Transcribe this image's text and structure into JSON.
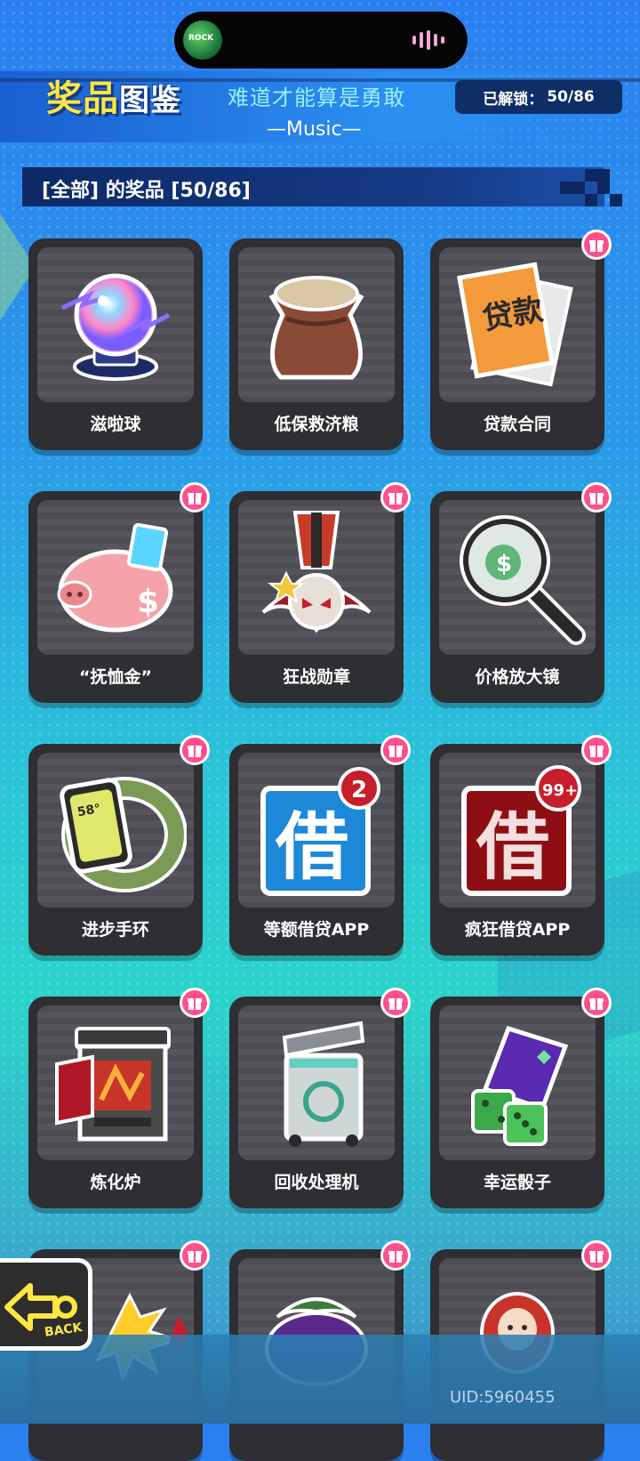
{
  "status": {
    "music_art_text": "ROCK"
  },
  "header": {
    "title_part1": "奖品",
    "title_part2": "图鉴",
    "song_title": "难道才能算是勇敢",
    "genre": "—Music—",
    "unlocked_label": "已解锁：",
    "unlocked_count": "50/86"
  },
  "section": {
    "title": "[全部] 的奖品 [50/86]"
  },
  "items": [
    {
      "name": "滋啦球",
      "gift": false
    },
    {
      "name": "低保救济粮",
      "gift": false
    },
    {
      "name": "贷款合同",
      "gift": true
    },
    {
      "name": "“抚恤金”",
      "gift": true
    },
    {
      "name": "狂战勋章",
      "gift": true
    },
    {
      "name": "价格放大镜",
      "gift": true
    },
    {
      "name": "进步手环",
      "gift": true
    },
    {
      "name": "等额借贷APP",
      "gift": true,
      "badge": "2",
      "app_char": "借"
    },
    {
      "name": "疯狂借贷APP",
      "gift": true,
      "badge": "99+",
      "app_char": "借"
    },
    {
      "name": "炼化炉",
      "gift": true
    },
    {
      "name": "回收处理机",
      "gift": true
    },
    {
      "name": "幸运骰子",
      "gift": true
    },
    {
      "name": "",
      "gift": true
    },
    {
      "name": "",
      "gift": true
    },
    {
      "name": "",
      "gift": true
    }
  ],
  "art_text": {
    "loan": "贷款",
    "watch": "58°"
  },
  "back": {
    "label": "BACK"
  },
  "footer": {
    "uid": "UID:5960455"
  },
  "colors": {
    "gift": "#ff4f8d",
    "title": "#ffe640",
    "card": "#2e2e33"
  }
}
